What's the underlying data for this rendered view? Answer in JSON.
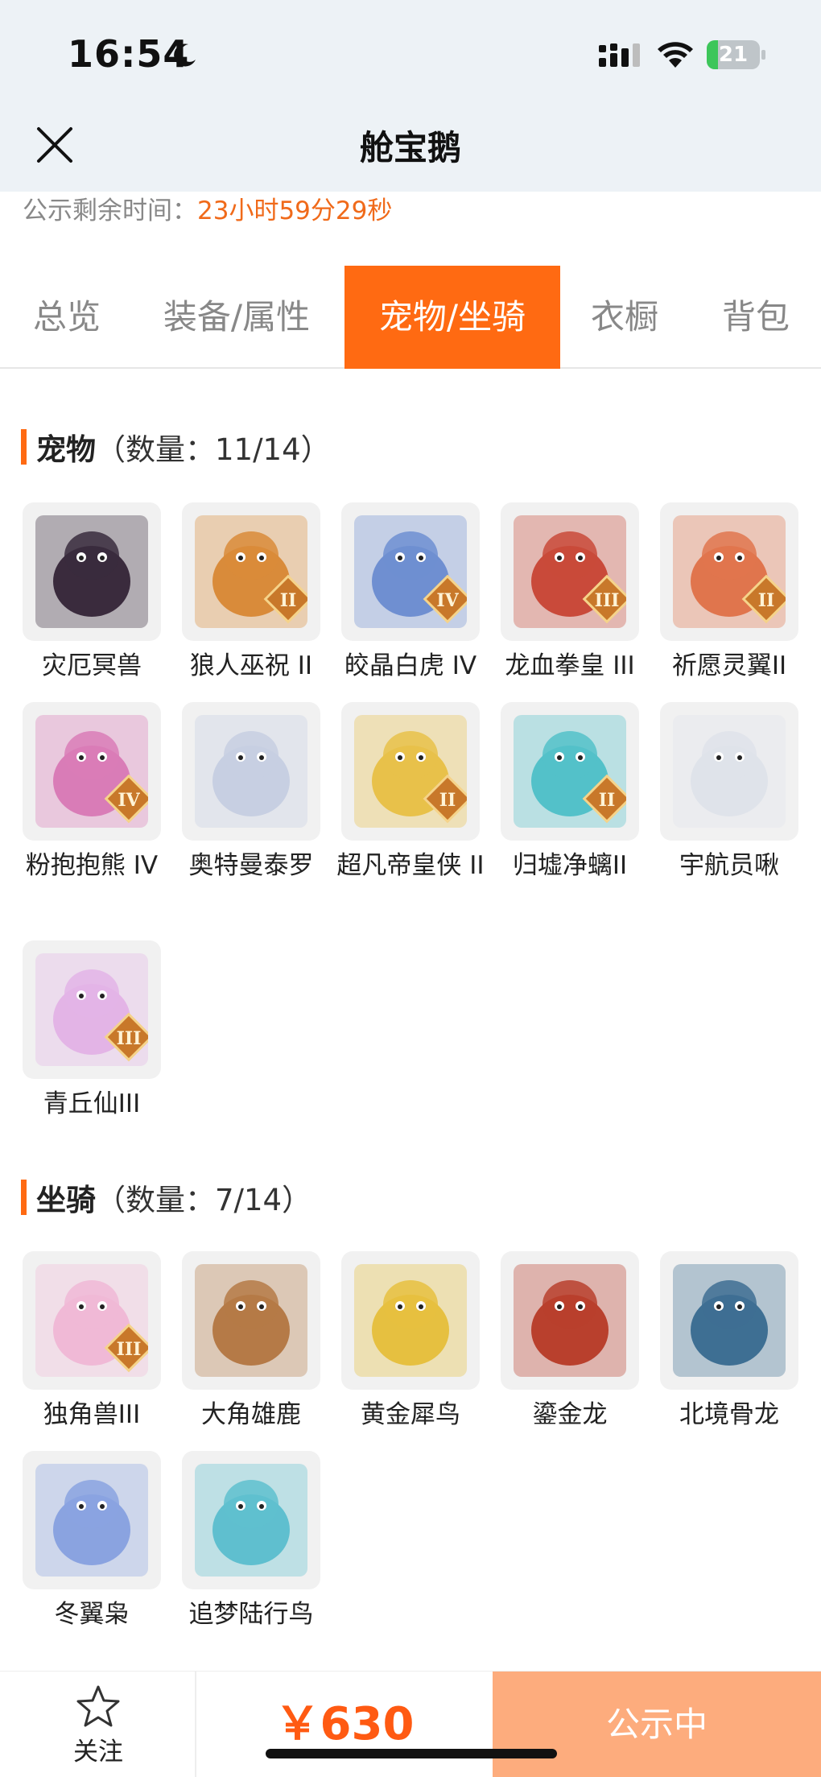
{
  "status_bar": {
    "time": "16:54",
    "battery_level": "21",
    "battery_percent": 21
  },
  "header": {
    "title": "舱宝鹅",
    "close_icon": "close-icon"
  },
  "countdown": {
    "label": "公示剩余时间：",
    "value": "23小时59分29秒"
  },
  "tabs": [
    {
      "label": "总览",
      "active": false
    },
    {
      "label": "装备/属性",
      "active": false
    },
    {
      "label": "宠物/坐骑",
      "active": true
    },
    {
      "label": "衣橱",
      "active": false
    },
    {
      "label": "背包",
      "active": false
    }
  ],
  "pets": {
    "title": "宠物",
    "count": "（数量：11/14）",
    "items": [
      {
        "name": "灾厄冥兽",
        "color": "#3a2b3d",
        "badge": ""
      },
      {
        "name": "狼人巫祝 II",
        "color": "#d98b3a",
        "badge": "II"
      },
      {
        "name": "皎晶白虎 IV",
        "color": "#6f8fd1",
        "badge": "IV"
      },
      {
        "name": "龙血拳皇 III",
        "color": "#c94a3a",
        "badge": "III"
      },
      {
        "name": "祈愿灵翼II",
        "color": "#e0754d",
        "badge": "II"
      },
      {
        "name": "粉抱抱熊 IV",
        "color": "#d97cb7",
        "badge": "IV"
      },
      {
        "name": "奥特曼泰罗",
        "color": "#c7cfe2",
        "badge": ""
      },
      {
        "name": "超凡帝皇侠 II",
        "color": "#e8c14a",
        "badge": "II"
      },
      {
        "name": "归墟净螭II",
        "color": "#53c1c9",
        "badge": "II"
      },
      {
        "name": "宇航员啾",
        "color": "#dfe3ea",
        "badge": ""
      },
      {
        "name": "青丘仙III",
        "color": "#e3b4e6",
        "badge": "III"
      }
    ]
  },
  "mounts": {
    "title": "坐骑",
    "count": "（数量：7/14）",
    "items": [
      {
        "name": "独角兽III",
        "color": "#f0b9d6",
        "badge": "III"
      },
      {
        "name": "大角雄鹿",
        "color": "#b57a47",
        "badge": ""
      },
      {
        "name": "黄金犀鸟",
        "color": "#e6c040",
        "badge": ""
      },
      {
        "name": "鎏金龙",
        "color": "#b9402d",
        "badge": ""
      },
      {
        "name": "北境骨龙",
        "color": "#3e6f93",
        "badge": ""
      },
      {
        "name": "冬翼枭",
        "color": "#8aa3e0",
        "badge": ""
      },
      {
        "name": "追梦陆行鸟",
        "color": "#5fbfcf",
        "badge": ""
      }
    ]
  },
  "bottom_bar": {
    "follow_label": "关注",
    "follow_icon": "star-icon",
    "price": "￥630",
    "status_button": "公示中"
  },
  "colors": {
    "accent": "#ff6a12",
    "countdown": "#f06a1a",
    "status_button_bg": "#fdac7d"
  }
}
